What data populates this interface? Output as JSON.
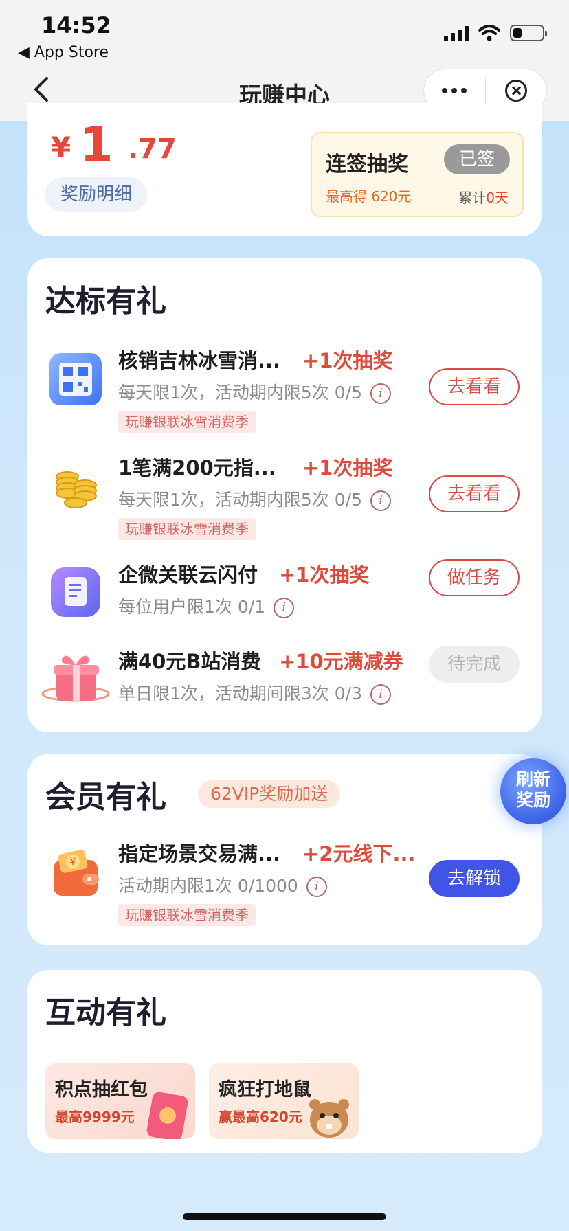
{
  "status_bar": {
    "time": "14:52",
    "back_app": "◀ App Store",
    "battery_level": 0.3
  },
  "nav": {
    "title": "玩赚中心"
  },
  "balance": {
    "currency": "¥",
    "amount_int": "1",
    "amount_dec": ".77",
    "detail_label": "奖励明细",
    "checkin": {
      "title": "连签抽奖",
      "status": "已签",
      "max_reward": "最高得 620元",
      "total_prefix": "累计",
      "total_days": "0天"
    }
  },
  "standard_rewards": {
    "title": "达标有礼",
    "tasks": [
      {
        "title": "核销吉林冰雪消...",
        "reward": "+1次抽奖",
        "desc": "每天限1次，活动期内限5次  0/5",
        "tag": "玩赚银联冰雪消费季",
        "button": "去看看",
        "icon": "qr-code-icon"
      },
      {
        "title": "1笔满200元指...",
        "reward": "+1次抽奖",
        "desc": "每天限1次，活动期内限5次  0/5",
        "tag": "玩赚银联冰雪消费季",
        "button": "去看看",
        "icon": "coins-icon"
      },
      {
        "title": "企微关联云闪付",
        "reward": "+1次抽奖",
        "desc": "每位用户限1次  0/1",
        "tag": "",
        "button": "做任务",
        "icon": "document-icon"
      },
      {
        "title": "满40元B站消费",
        "reward": "+10元满减券",
        "desc": "单日限1次，活动期间限3次  0/3",
        "tag": "",
        "button": "待完成",
        "icon": "gift-box-icon"
      }
    ]
  },
  "vip_rewards": {
    "title": "会员有礼",
    "badge": "62VIP奖励加送",
    "refresh_label_1": "刷新",
    "refresh_label_2": "奖励",
    "task": {
      "title": "指定场景交易满...",
      "reward": "+2元线下...",
      "desc": "活动期内限1次  0/1000",
      "tag": "玩赚银联冰雪消费季",
      "button": "去解锁",
      "icon": "wallet-icon"
    }
  },
  "interactive_rewards": {
    "title": "互动有礼",
    "games": [
      {
        "title": "积点抽红包",
        "subtitle": "最高9999元",
        "icon": "red-envelope-icon"
      },
      {
        "title": "疯狂打地鼠",
        "subtitle": "赢最高620元",
        "icon": "hamster-icon"
      }
    ]
  },
  "colors": {
    "accent_red": "#e04a3a",
    "primary_blue": "#4055e6",
    "background": "#cfe7fb"
  }
}
